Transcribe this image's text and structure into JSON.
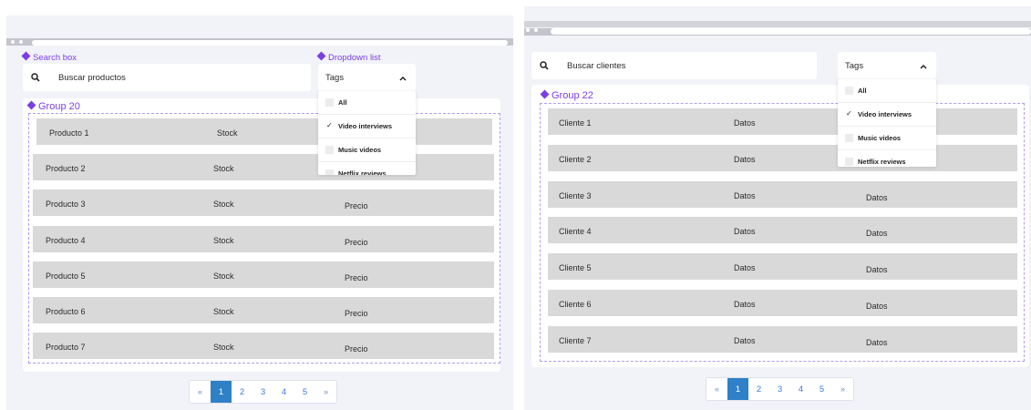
{
  "left": {
    "search_box_label": "Search box",
    "dropdown_list_label": "Dropdown list",
    "search_placeholder": "Buscar productos",
    "tags_label": "Tags",
    "group_label": "Group 20",
    "dropdown_items": [
      {
        "label": "All",
        "checked": false
      },
      {
        "label": "Video interviews",
        "checked": true
      },
      {
        "label": "Music videos",
        "checked": false
      },
      {
        "label": "Netflix reviews",
        "checked": false
      }
    ],
    "rows": [
      {
        "name": "Producto 1",
        "col2": "Stock",
        "col3": ""
      },
      {
        "name": "Producto 2",
        "col2": "Stock",
        "col3": ""
      },
      {
        "name": "Producto 3",
        "col2": "Stock",
        "col3": "Precio"
      },
      {
        "name": "Producto 4",
        "col2": "Stock",
        "col3": "Precio"
      },
      {
        "name": "Producto 5",
        "col2": "Stock",
        "col3": "Precio"
      },
      {
        "name": "Producto 6",
        "col2": "Stock",
        "col3": "Precio"
      },
      {
        "name": "Producto 7",
        "col2": "Stock",
        "col3": "Precio"
      }
    ],
    "pagination": {
      "prev": "«",
      "pages": [
        "1",
        "2",
        "3",
        "4",
        "5"
      ],
      "next": "»",
      "current": "1"
    }
  },
  "right": {
    "search_placeholder": "Buscar clientes",
    "tags_label": "Tags",
    "group_label": "Group 22",
    "dropdown_items": [
      {
        "label": "All",
        "checked": false
      },
      {
        "label": "Video interviews",
        "checked": true
      },
      {
        "label": "Music videos",
        "checked": false
      },
      {
        "label": "Netflix reviews",
        "checked": false
      }
    ],
    "rows": [
      {
        "name": "Cliente 1",
        "col2": "Datos",
        "col3": ""
      },
      {
        "name": "Cliente 2",
        "col2": "Datos",
        "col3": ""
      },
      {
        "name": "Cliente 3",
        "col2": "Datos",
        "col3": "Datos"
      },
      {
        "name": "Cliente 4",
        "col2": "Datos",
        "col3": "Datos"
      },
      {
        "name": "Cliente 5",
        "col2": "Datos",
        "col3": "Datos"
      },
      {
        "name": "Cliente 6",
        "col2": "Datos",
        "col3": "Datos"
      },
      {
        "name": "Cliente 7",
        "col2": "Datos",
        "col3": "Datos"
      }
    ],
    "pagination": {
      "prev": "«",
      "pages": [
        "1",
        "2",
        "3",
        "4",
        "5"
      ],
      "next": "»",
      "current": "1"
    }
  },
  "colors": {
    "accent_purple": "#7b3fe4",
    "pager_active": "#2f80c7",
    "row_gray": "#d9d9d9",
    "background": "#f1f3f8"
  },
  "icons": [
    "search-icon",
    "chevron-up-icon",
    "check-icon"
  ]
}
